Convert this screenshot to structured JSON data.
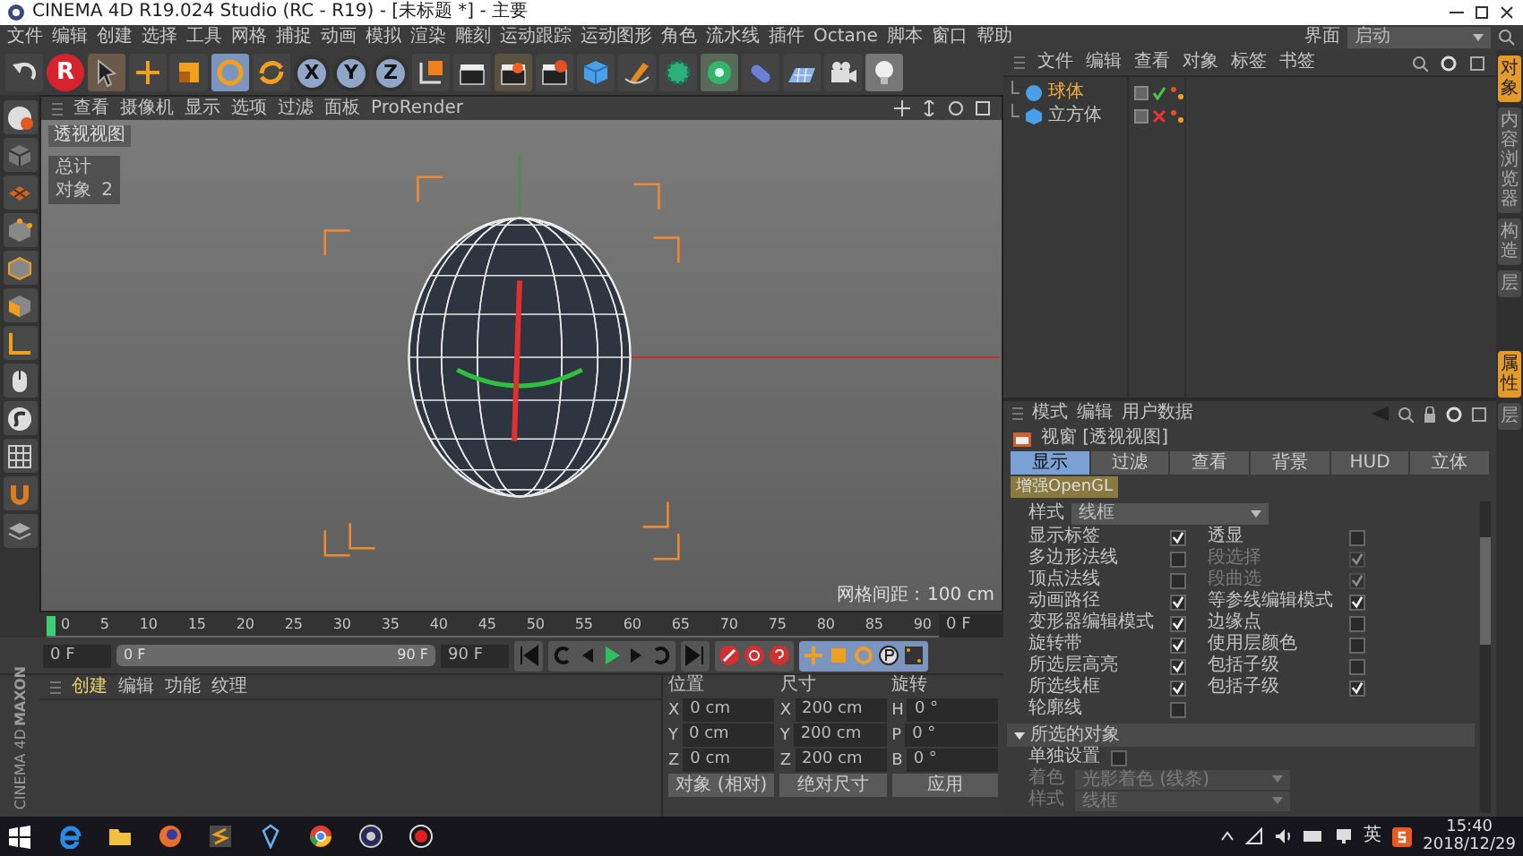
{
  "window": {
    "title": "CINEMA 4D R19.024 Studio (RC - R19) - [未标题 *] - 主要"
  },
  "menu": [
    "文件",
    "编辑",
    "创建",
    "选择",
    "工具",
    "网格",
    "捕捉",
    "动画",
    "模拟",
    "渲染",
    "雕刻",
    "运动跟踪",
    "运动图形",
    "角色",
    "流水线",
    "插件",
    "Octane",
    "脚本",
    "窗口",
    "帮助"
  ],
  "layout": {
    "label": "界面",
    "value": "启动"
  },
  "toolbar": {
    "logo": "R",
    "axis_locks": [
      {
        "label": "X",
        "on": true
      },
      {
        "label": "Y",
        "on": true
      },
      {
        "label": "Z",
        "on": true
      }
    ]
  },
  "viewport": {
    "menu": [
      "查看",
      "摄像机",
      "显示",
      "选项",
      "过滤",
      "面板",
      "ProRender"
    ],
    "camera_label": "透视视图",
    "hud": {
      "title": "总计",
      "rows": [
        {
          "label": "对象",
          "value": "2"
        }
      ]
    },
    "grid_spacing": {
      "label": "网格间距 :",
      "value": "100 cm"
    }
  },
  "timeline": {
    "ticks": [
      "0",
      "5",
      "10",
      "15",
      "20",
      "25",
      "30",
      "35",
      "40",
      "45",
      "50",
      "55",
      "60",
      "65",
      "70",
      "75",
      "80",
      "85",
      "90"
    ],
    "playhead": {
      "level": 0
    },
    "current": "0 F"
  },
  "transport": {
    "start": "0 F",
    "range_start": "0 F",
    "range_end": "90 F",
    "range_level": {
      "level": 1
    },
    "end": "90 F"
  },
  "object_manager": {
    "menu": [
      "文件",
      "编辑",
      "查看",
      "对象",
      "标签",
      "书签"
    ],
    "objects": [
      {
        "name": "球体",
        "kind": "sphere",
        "selected": true,
        "enabled": true
      },
      {
        "name": "立方体",
        "kind": "cube",
        "selected": false,
        "enabled": false
      }
    ]
  },
  "side_tabs_top": [
    {
      "label": "对象",
      "selected": true
    },
    {
      "label": "内容浏览器",
      "selected": false
    },
    {
      "label": "构造",
      "selected": false
    },
    {
      "label": "层",
      "selected": false
    }
  ],
  "side_tabs_bottom": [
    {
      "label": "属性",
      "selected": true
    },
    {
      "label": "层",
      "selected": false
    }
  ],
  "attributes": {
    "menu": [
      "模式",
      "编辑",
      "用户数据"
    ],
    "title": "视窗 [透视视图]",
    "tabs": [
      {
        "label": "显示",
        "selected": true
      },
      {
        "label": "过滤",
        "selected": false
      },
      {
        "label": "查看",
        "selected": false
      },
      {
        "label": "背景",
        "selected": false
      },
      {
        "label": "HUD",
        "selected": false
      },
      {
        "label": "立体",
        "selected": false
      }
    ],
    "subtabs": [
      {
        "label": "增强OpenGL",
        "selected": true
      }
    ],
    "style": {
      "label": "样式",
      "value": "线框"
    },
    "options": [
      {
        "label": "显示标签",
        "checked": true,
        "disabled": false
      },
      {
        "label": "透显",
        "checked": false,
        "disabled": false
      },
      {
        "label": "多边形法线",
        "checked": false,
        "disabled": false
      },
      {
        "label": "段选择",
        "checked": true,
        "disabled": true
      },
      {
        "label": "顶点法线",
        "checked": false,
        "disabled": false
      },
      {
        "label": "段曲选",
        "checked": true,
        "disabled": true
      },
      {
        "label": "动画路径",
        "checked": true,
        "disabled": false
      },
      {
        "label": "等参线编辑模式",
        "checked": true,
        "disabled": false
      },
      {
        "label": "变形器编辑模式",
        "checked": true,
        "disabled": false
      },
      {
        "label": "边缘点",
        "checked": false,
        "disabled": false
      },
      {
        "label": "旋转带",
        "checked": true,
        "disabled": false
      },
      {
        "label": "使用层颜色",
        "checked": false,
        "disabled": false
      },
      {
        "label": "所选层高亮",
        "checked": true,
        "disabled": false
      },
      {
        "label": "包括子级",
        "checked": false,
        "disabled": false
      },
      {
        "label": "所选线框",
        "checked": true,
        "disabled": false
      },
      {
        "label": "包括子级",
        "checked": true,
        "disabled": false
      },
      {
        "label": "轮廓线",
        "checked": false,
        "disabled": false
      }
    ],
    "section": {
      "label": "所选的对象",
      "expanded": true
    },
    "section_options": [
      {
        "kind": "checkbox",
        "label": "单独设置",
        "checked": false,
        "disabled": false
      },
      {
        "kind": "select",
        "label": "着色",
        "value": "光影着色 (线条)",
        "disabled": true
      },
      {
        "kind": "select",
        "label": "样式",
        "value": "线框",
        "disabled": true
      }
    ]
  },
  "material_manager": {
    "menu": [
      "创建",
      "编辑",
      "功能",
      "纹理"
    ],
    "brand": [
      "MAXON",
      "CINEMA 4D"
    ]
  },
  "coordinates": {
    "headers": [
      "位置",
      "尺寸",
      "旋转"
    ],
    "rows": [
      [
        {
          "axis": "X",
          "value": "0 cm"
        },
        {
          "axis": "X",
          "value": "200 cm"
        },
        {
          "axis": "H",
          "value": "0 °"
        }
      ],
      [
        {
          "axis": "Y",
          "value": "0 cm"
        },
        {
          "axis": "Y",
          "value": "200 cm"
        },
        {
          "axis": "P",
          "value": "0 °"
        }
      ],
      [
        {
          "axis": "Z",
          "value": "0 cm"
        },
        {
          "axis": "Z",
          "value": "200 cm"
        },
        {
          "axis": "B",
          "value": "0 °"
        }
      ]
    ],
    "mode": "对象 (相对)",
    "size_mode": "绝对尺寸",
    "apply": "应用"
  },
  "taskbar": {
    "ime": "英",
    "time": "15:40",
    "date": "2018/12/29"
  }
}
